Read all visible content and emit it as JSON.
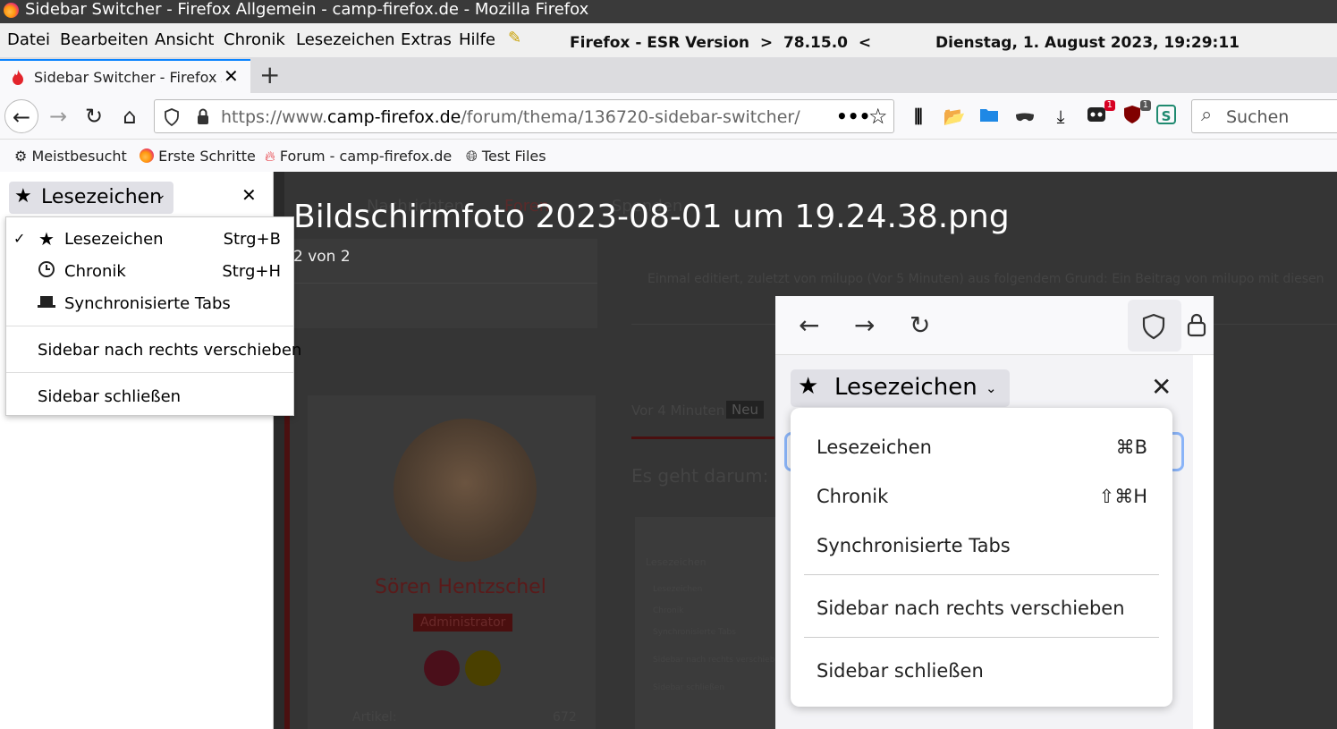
{
  "window": {
    "title": "Sidebar Switcher - Firefox Allgemein - camp-firefox.de - Mozilla Firefox"
  },
  "menubar": {
    "items": [
      "Datei",
      "Bearbeiten",
      "Ansicht",
      "Chronik",
      "Lesezeichen",
      "Extras",
      "Hilfe"
    ],
    "info_version": "Firefox - ESR Version  >  78.15.0  <",
    "info_datetime": "Dienstag, 1. August 2023, 19:29:11"
  },
  "tabs": [
    {
      "label": "Sidebar Switcher - Firefox Allgemein",
      "active": true
    }
  ],
  "navbar": {
    "url_prefix": "https://www.",
    "url_domain": "camp-firefox.de",
    "url_path": "/forum/thema/136720-sidebar-switcher/",
    "search_placeholder": "Suchen",
    "badge_1": "1",
    "badge_2": "1"
  },
  "bookmarks": [
    "Meistbesucht",
    "Erste Schritte",
    "Forum - camp-firefox.de",
    "Test Files"
  ],
  "sidebar": {
    "header_label": "Lesezeichen",
    "menu": [
      {
        "label": "Lesezeichen",
        "shortcut": "Strg+B",
        "checked": true
      },
      {
        "label": "Chronik",
        "shortcut": "Strg+H",
        "checked": false
      },
      {
        "label": "Synchronisierte Tabs",
        "shortcut": "",
        "checked": false
      }
    ],
    "move_label": "Sidebar nach rechts verschieben",
    "close_label": "Sidebar schließen"
  },
  "content": {
    "viewer_title": "Bildschirmfoto 2023-08-01 um 19.24.38.png",
    "viewer_count": "2 von 2",
    "bg_nav": [
      "Nachrichten",
      "Foren",
      "Spenden"
    ],
    "bg_edit_note": "Einmal editiert, zuletzt von milupo (Vor 5 Minuten) aus folgendem Grund: Ein Beitrag von milupo mit diesen",
    "bg_time": "Vor 4 Minuten",
    "bg_new": "Neu",
    "bg_text": "Es geht darum:",
    "bg_user": "Sören Hentzschel",
    "bg_role": "Administrator",
    "bg_articles_label": "Artikel:",
    "bg_articles_count": "672",
    "bg_mini": [
      "Lesezeichen",
      "Lesezeichen",
      "Chronik",
      "Synchronisierte Tabs",
      "Sidebar nach rechts verschieben",
      "Sidebar schließen"
    ]
  },
  "embedded": {
    "header_label": "Lesezeichen",
    "menu": [
      {
        "label": "Lesezeichen",
        "shortcut": "⌘B"
      },
      {
        "label": "Chronik",
        "shortcut": "⇧⌘H"
      },
      {
        "label": "Synchronisierte Tabs",
        "shortcut": ""
      }
    ],
    "move_label": "Sidebar nach rechts verschieben",
    "close_label": "Sidebar schließen"
  }
}
